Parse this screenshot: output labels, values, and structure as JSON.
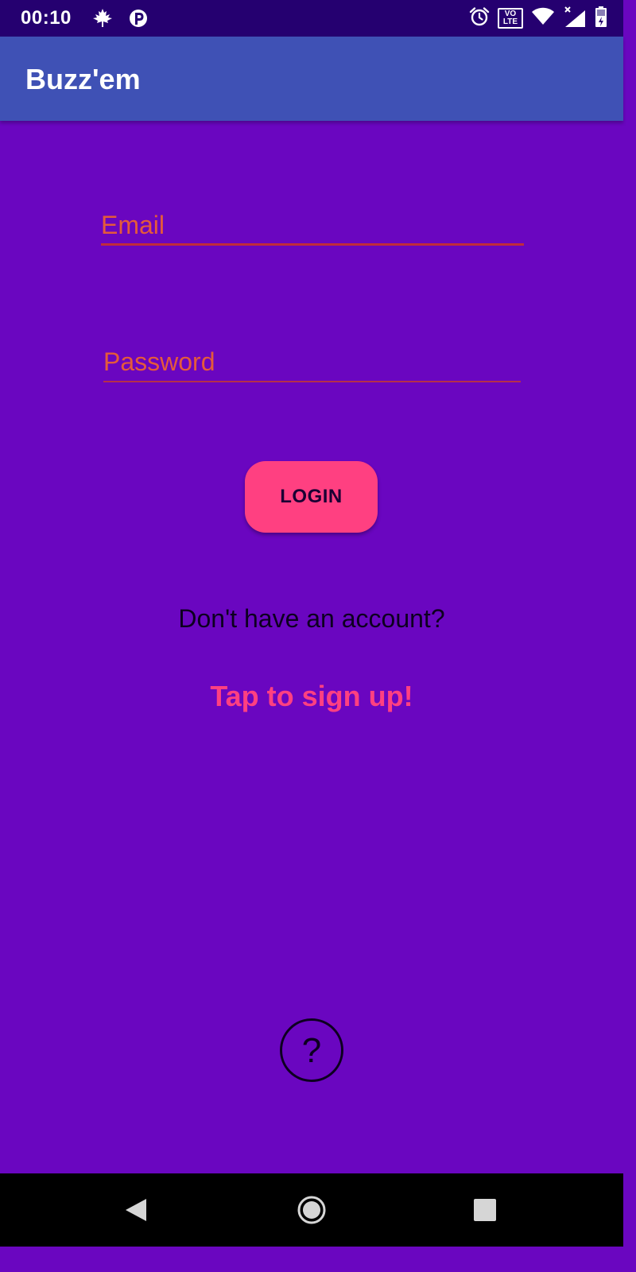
{
  "status_bar": {
    "time": "00:10",
    "left_icons": [
      "maple-leaf-icon",
      "p-icon"
    ],
    "right_icons": [
      "alarm-icon",
      "volte-icon",
      "wifi-icon",
      "cellular-signal-icon",
      "battery-icon"
    ],
    "volte_top": "VO",
    "volte_bottom": "LTE"
  },
  "app_bar": {
    "title": "Buzz'em"
  },
  "form": {
    "email_placeholder": "Email",
    "email_value": "",
    "password_placeholder": "Password",
    "password_value": "",
    "login_label": "LOGIN"
  },
  "signup": {
    "prompt": "Don't have an account?",
    "link": "Tap to sign up!"
  },
  "help": {
    "glyph": "?"
  },
  "nav_bar": {
    "buttons": [
      "back-icon",
      "home-icon",
      "recents-icon"
    ]
  },
  "colors": {
    "status_bar": "#250070",
    "app_bar": "#3f51b5",
    "background": "#6a06c0",
    "accent": "#ff4081",
    "input_text": "#e55a3a"
  }
}
